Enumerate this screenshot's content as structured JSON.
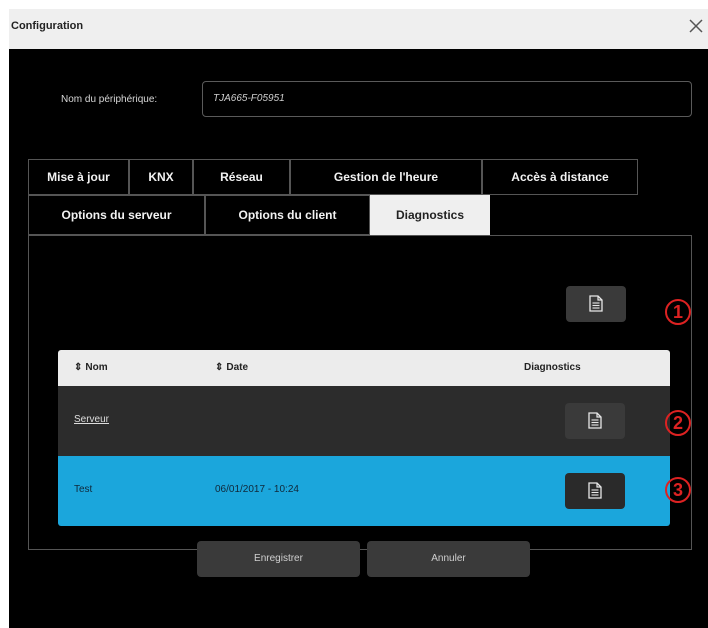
{
  "window": {
    "title": "Configuration",
    "close_icon": "close-icon"
  },
  "device": {
    "label": "Nom du périphérique:",
    "value": "TJA665-F05951"
  },
  "tabs_row1": [
    "Mise à jour",
    "KNX",
    "Réseau",
    "Gestion de l'heure",
    "Accès à distance"
  ],
  "tabs_row2": [
    "Options du serveur",
    "Options du client",
    "Diagnostics"
  ],
  "active_tab": "Diagnostics",
  "table": {
    "columns": [
      "Nom",
      "Date",
      "Diagnostics"
    ],
    "rows": [
      {
        "name": "Serveur",
        "date": "",
        "link": true
      },
      {
        "name": "Test",
        "date": "06/01/2017 - 10:24",
        "selected": true
      }
    ]
  },
  "callouts": [
    "1",
    "2",
    "3"
  ],
  "footer": {
    "save": "Enregistrer",
    "cancel": "Annuler"
  },
  "colors": {
    "selected_row": "#1ba6dc",
    "callout": "#dd2222"
  }
}
